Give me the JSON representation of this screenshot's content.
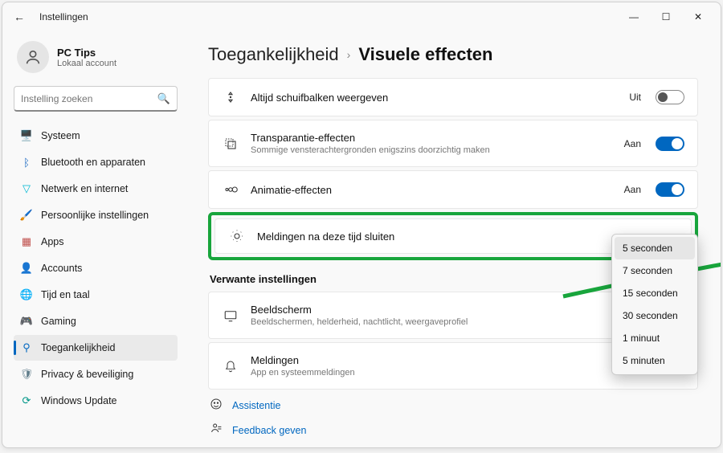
{
  "titlebar": {
    "title": "Instellingen"
  },
  "profile": {
    "name": "PC Tips",
    "sub": "Lokaal account"
  },
  "search": {
    "placeholder": "Instelling zoeken"
  },
  "nav": {
    "items": [
      {
        "label": "Systeem",
        "icon": "system",
        "color": "#1976d2"
      },
      {
        "label": "Bluetooth en apparaten",
        "icon": "bt",
        "color": "#1565c0"
      },
      {
        "label": "Netwerk en internet",
        "icon": "net",
        "color": "#00b8d4"
      },
      {
        "label": "Persoonlijke instellingen",
        "icon": "pers",
        "color": "#6a4caf"
      },
      {
        "label": "Apps",
        "icon": "apps",
        "color": "#c0504d"
      },
      {
        "label": "Accounts",
        "icon": "acct",
        "color": "#e6a23c"
      },
      {
        "label": "Tijd en taal",
        "icon": "time",
        "color": "#d8792c"
      },
      {
        "label": "Gaming",
        "icon": "game",
        "color": "#4caf50"
      },
      {
        "label": "Toegankelijkheid",
        "icon": "access",
        "color": "#0067c0"
      },
      {
        "label": "Privacy & beveiliging",
        "icon": "priv",
        "color": "#607d8b"
      },
      {
        "label": "Windows Update",
        "icon": "update",
        "color": "#009688"
      }
    ],
    "activeIndex": 8
  },
  "crumbs": {
    "parent": "Toegankelijkheid",
    "current": "Visuele effecten"
  },
  "rows": {
    "scrollbars": {
      "title": "Altijd schuifbalken weergeven",
      "state": "Uit"
    },
    "transparency": {
      "title": "Transparantie-effecten",
      "sub": "Sommige vensterachtergronden enigszins doorzichtig maken",
      "state": "Aan"
    },
    "animation": {
      "title": "Animatie-effecten",
      "state": "Aan"
    },
    "notifications": {
      "title": "Meldingen na deze tijd sluiten",
      "value": "5 seconden"
    }
  },
  "related": {
    "heading": "Verwante instellingen",
    "display": {
      "title": "Beeldscherm",
      "sub": "Beeldschermen, helderheid, nachtlicht, weergaveprofiel"
    },
    "notifs": {
      "title": "Meldingen",
      "sub": "App en systeemmeldingen"
    }
  },
  "links": {
    "assist": "Assistentie",
    "feedback": "Feedback geven"
  },
  "dropdown": {
    "options": [
      "5 seconden",
      "7 seconden",
      "15 seconden",
      "30 seconden",
      "1 minuut",
      "5 minuten"
    ],
    "selected": "5 seconden"
  }
}
